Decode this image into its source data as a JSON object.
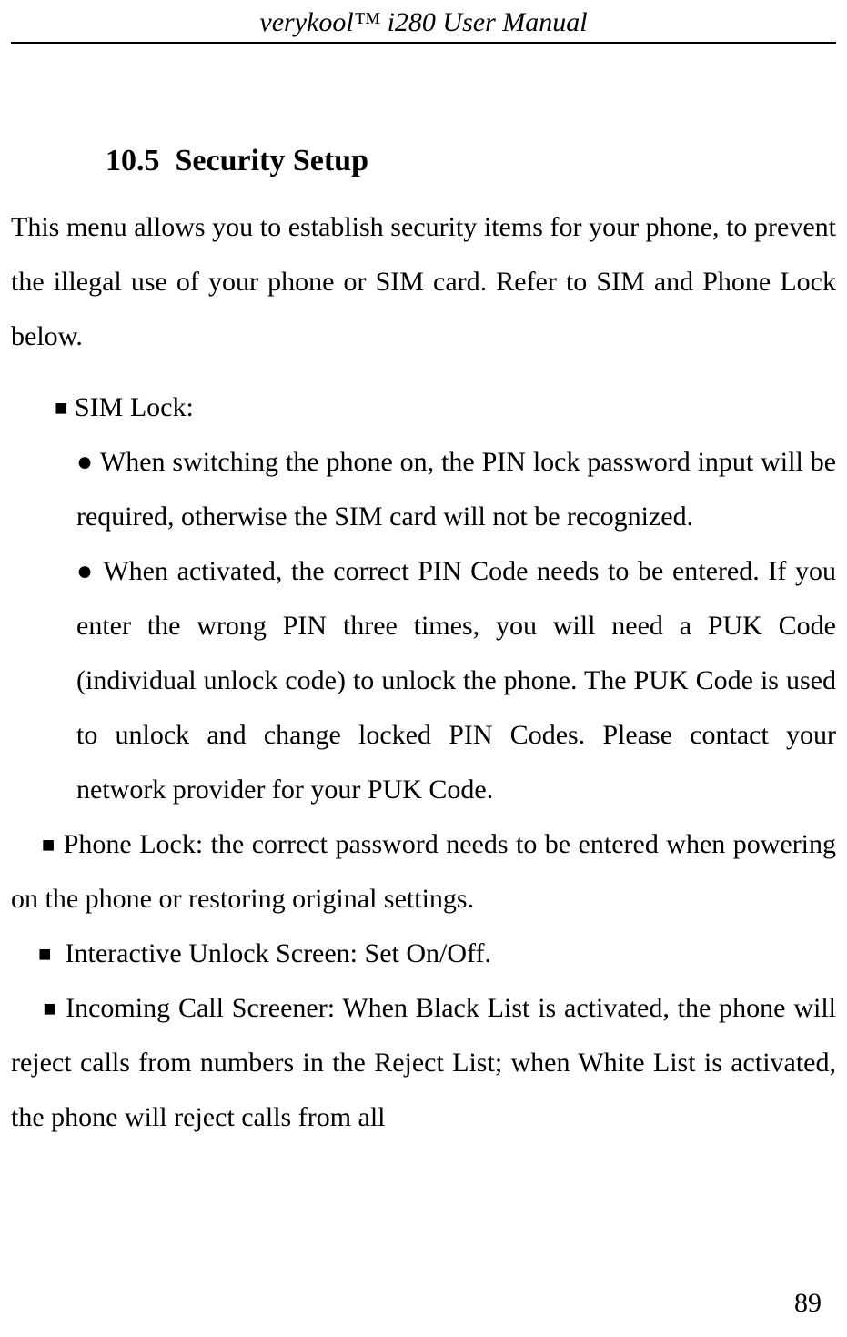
{
  "header": {
    "title": "verykool™ i280 User Manual"
  },
  "section": {
    "number": "10.5",
    "title": "Security Setup"
  },
  "intro": "This menu allows you to establish security items for your phone, to prevent the illegal use of your phone or SIM card. Refer to SIM and Phone Lock below.",
  "items": [
    {
      "label": "SIM Lock:",
      "sub": [
        "When switching the phone on, the PIN lock password input will be required, otherwise the SIM card will not be recognized.",
        "When activated, the correct PIN Code needs to be entered. If you enter the wrong PIN three times, you will need a PUK Code (individual unlock code) to unlock the phone. The PUK Code is used to unlock and change locked PIN Codes. Please contact your network provider for your PUK Code."
      ]
    },
    {
      "text": "Phone Lock: the correct password needs to be entered when powering on the phone or restoring original settings."
    },
    {
      "text": "Interactive Unlock Screen: Set On/Off."
    },
    {
      "text": "Incoming Call Screener: When Black List is activated, the phone will reject calls from numbers in the Reject List; when White List is activated, the phone will reject calls from all"
    }
  ],
  "page_number": "89"
}
